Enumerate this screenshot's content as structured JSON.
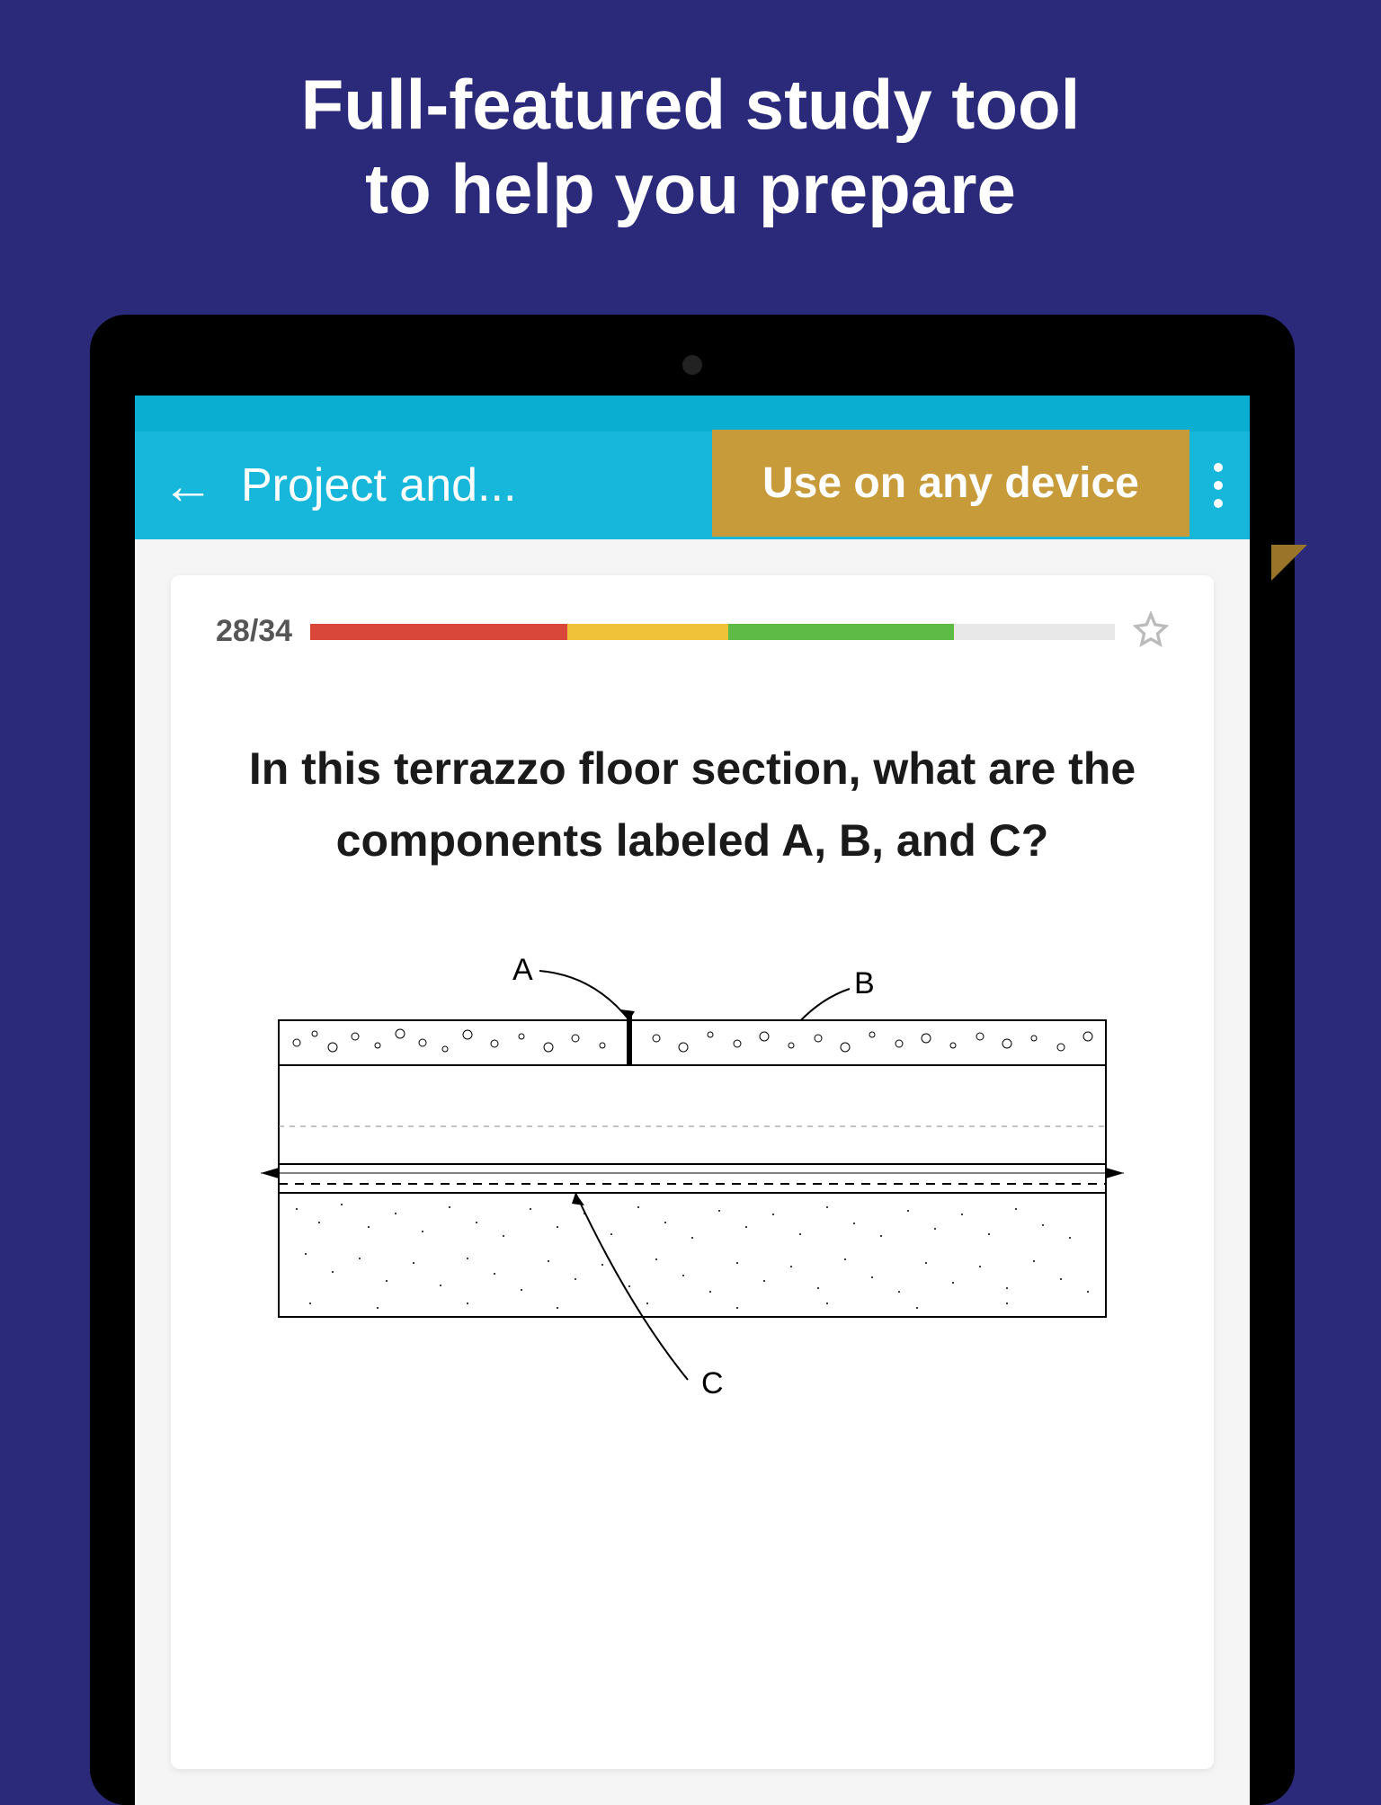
{
  "headline": {
    "line1": "Full-featured study tool",
    "line2": "to help you prepare"
  },
  "callout": "Use on any device",
  "header": {
    "title": "Project and..."
  },
  "card": {
    "counter": "28/34",
    "question": "In this terrazzo floor section, what are the components labeled A, B, and C?",
    "labels": {
      "a": "A",
      "b": "B",
      "c": "C"
    }
  }
}
